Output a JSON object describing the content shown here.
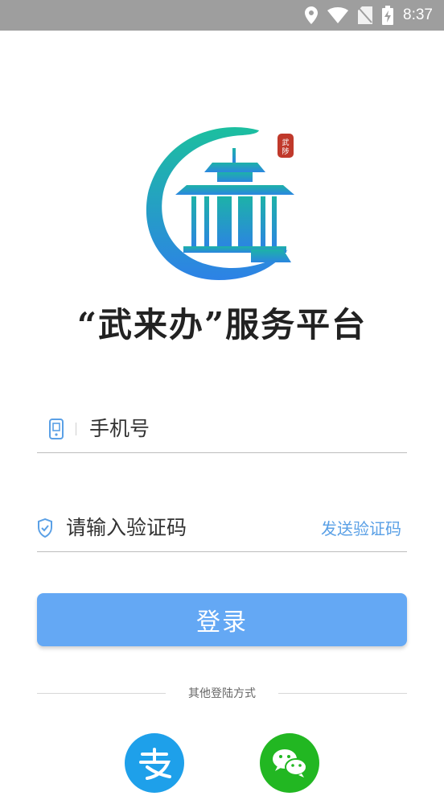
{
  "status_bar": {
    "time": "8:37"
  },
  "app": {
    "title": "“武来办”服务平台",
    "logo_seal_text": "武陟"
  },
  "form": {
    "phone_placeholder": "手机号",
    "code_placeholder": "请输入验证码",
    "send_code_label": "发送验证码",
    "login_label": "登录"
  },
  "other_login": {
    "label": "其他登陆方式",
    "methods": [
      "alipay",
      "wechat"
    ]
  },
  "icons": {
    "phone": "phone-icon",
    "shield": "shield-check-icon",
    "alipay": "alipay-icon",
    "wechat": "wechat-icon"
  },
  "colors": {
    "accent": "#64a8f4",
    "link": "#5aa0e6",
    "alipay": "#1ea0ea",
    "wechat": "#22b722",
    "status_bar": "#9e9e9e"
  }
}
